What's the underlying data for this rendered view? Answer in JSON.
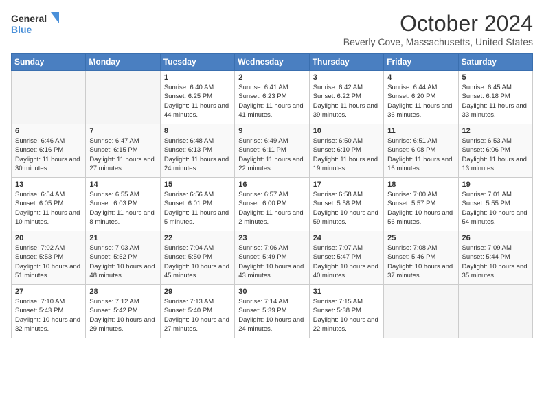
{
  "header": {
    "logo_line1": "General",
    "logo_line2": "Blue",
    "month": "October 2024",
    "location": "Beverly Cove, Massachusetts, United States"
  },
  "columns": [
    "Sunday",
    "Monday",
    "Tuesday",
    "Wednesday",
    "Thursday",
    "Friday",
    "Saturday"
  ],
  "weeks": [
    [
      {
        "day": "",
        "info": ""
      },
      {
        "day": "",
        "info": ""
      },
      {
        "day": "1",
        "sunrise": "6:40 AM",
        "sunset": "6:25 PM",
        "daylight": "11 hours and 44 minutes."
      },
      {
        "day": "2",
        "sunrise": "6:41 AM",
        "sunset": "6:23 PM",
        "daylight": "11 hours and 41 minutes."
      },
      {
        "day": "3",
        "sunrise": "6:42 AM",
        "sunset": "6:22 PM",
        "daylight": "11 hours and 39 minutes."
      },
      {
        "day": "4",
        "sunrise": "6:44 AM",
        "sunset": "6:20 PM",
        "daylight": "11 hours and 36 minutes."
      },
      {
        "day": "5",
        "sunrise": "6:45 AM",
        "sunset": "6:18 PM",
        "daylight": "11 hours and 33 minutes."
      }
    ],
    [
      {
        "day": "6",
        "sunrise": "6:46 AM",
        "sunset": "6:16 PM",
        "daylight": "11 hours and 30 minutes."
      },
      {
        "day": "7",
        "sunrise": "6:47 AM",
        "sunset": "6:15 PM",
        "daylight": "11 hours and 27 minutes."
      },
      {
        "day": "8",
        "sunrise": "6:48 AM",
        "sunset": "6:13 PM",
        "daylight": "11 hours and 24 minutes."
      },
      {
        "day": "9",
        "sunrise": "6:49 AM",
        "sunset": "6:11 PM",
        "daylight": "11 hours and 22 minutes."
      },
      {
        "day": "10",
        "sunrise": "6:50 AM",
        "sunset": "6:10 PM",
        "daylight": "11 hours and 19 minutes."
      },
      {
        "day": "11",
        "sunrise": "6:51 AM",
        "sunset": "6:08 PM",
        "daylight": "11 hours and 16 minutes."
      },
      {
        "day": "12",
        "sunrise": "6:53 AM",
        "sunset": "6:06 PM",
        "daylight": "11 hours and 13 minutes."
      }
    ],
    [
      {
        "day": "13",
        "sunrise": "6:54 AM",
        "sunset": "6:05 PM",
        "daylight": "11 hours and 10 minutes."
      },
      {
        "day": "14",
        "sunrise": "6:55 AM",
        "sunset": "6:03 PM",
        "daylight": "11 hours and 8 minutes."
      },
      {
        "day": "15",
        "sunrise": "6:56 AM",
        "sunset": "6:01 PM",
        "daylight": "11 hours and 5 minutes."
      },
      {
        "day": "16",
        "sunrise": "6:57 AM",
        "sunset": "6:00 PM",
        "daylight": "11 hours and 2 minutes."
      },
      {
        "day": "17",
        "sunrise": "6:58 AM",
        "sunset": "5:58 PM",
        "daylight": "10 hours and 59 minutes."
      },
      {
        "day": "18",
        "sunrise": "7:00 AM",
        "sunset": "5:57 PM",
        "daylight": "10 hours and 56 minutes."
      },
      {
        "day": "19",
        "sunrise": "7:01 AM",
        "sunset": "5:55 PM",
        "daylight": "10 hours and 54 minutes."
      }
    ],
    [
      {
        "day": "20",
        "sunrise": "7:02 AM",
        "sunset": "5:53 PM",
        "daylight": "10 hours and 51 minutes."
      },
      {
        "day": "21",
        "sunrise": "7:03 AM",
        "sunset": "5:52 PM",
        "daylight": "10 hours and 48 minutes."
      },
      {
        "day": "22",
        "sunrise": "7:04 AM",
        "sunset": "5:50 PM",
        "daylight": "10 hours and 45 minutes."
      },
      {
        "day": "23",
        "sunrise": "7:06 AM",
        "sunset": "5:49 PM",
        "daylight": "10 hours and 43 minutes."
      },
      {
        "day": "24",
        "sunrise": "7:07 AM",
        "sunset": "5:47 PM",
        "daylight": "10 hours and 40 minutes."
      },
      {
        "day": "25",
        "sunrise": "7:08 AM",
        "sunset": "5:46 PM",
        "daylight": "10 hours and 37 minutes."
      },
      {
        "day": "26",
        "sunrise": "7:09 AM",
        "sunset": "5:44 PM",
        "daylight": "10 hours and 35 minutes."
      }
    ],
    [
      {
        "day": "27",
        "sunrise": "7:10 AM",
        "sunset": "5:43 PM",
        "daylight": "10 hours and 32 minutes."
      },
      {
        "day": "28",
        "sunrise": "7:12 AM",
        "sunset": "5:42 PM",
        "daylight": "10 hours and 29 minutes."
      },
      {
        "day": "29",
        "sunrise": "7:13 AM",
        "sunset": "5:40 PM",
        "daylight": "10 hours and 27 minutes."
      },
      {
        "day": "30",
        "sunrise": "7:14 AM",
        "sunset": "5:39 PM",
        "daylight": "10 hours and 24 minutes."
      },
      {
        "day": "31",
        "sunrise": "7:15 AM",
        "sunset": "5:38 PM",
        "daylight": "10 hours and 22 minutes."
      },
      {
        "day": "",
        "info": ""
      },
      {
        "day": "",
        "info": ""
      }
    ]
  ],
  "colors": {
    "header_bg": "#4a7fc1",
    "accent": "#4a90d9"
  }
}
